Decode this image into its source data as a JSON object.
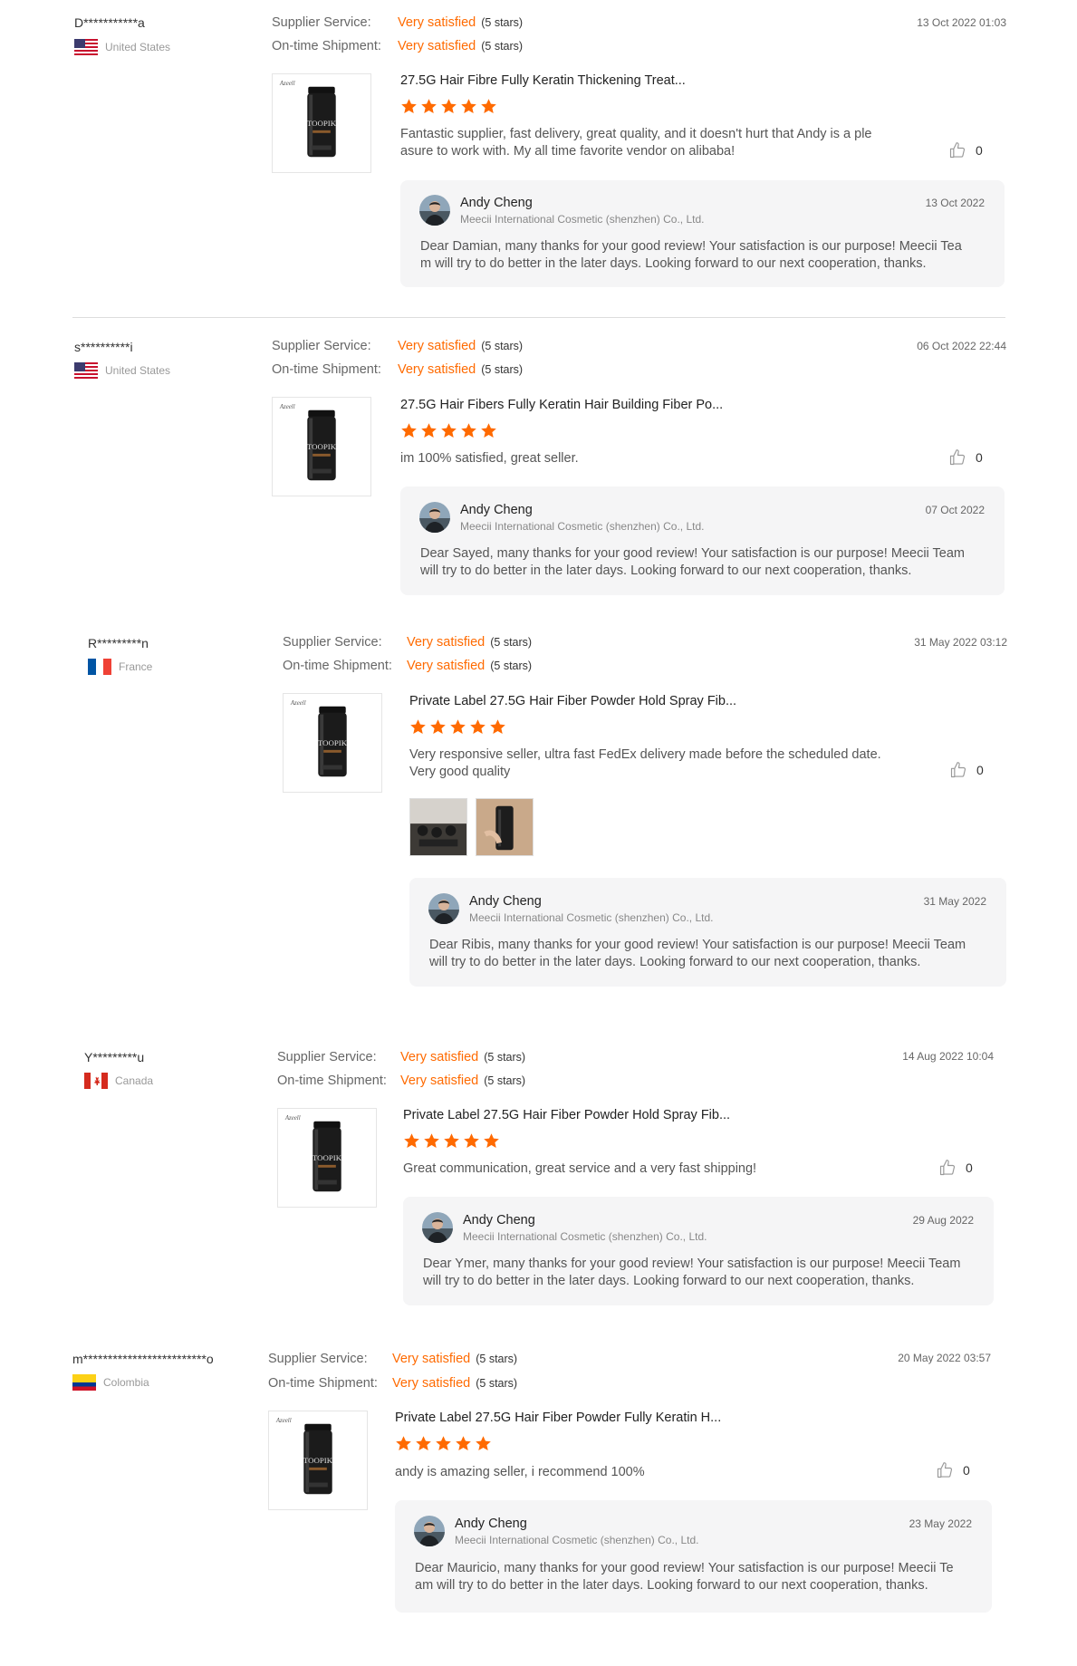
{
  "colors": {
    "accent": "#ff6a00",
    "star": "#ff6a00"
  },
  "labels": {
    "supplier_service": "Supplier Service:",
    "on_time_shipment": "On-time Shipment:"
  },
  "reviews": [
    {
      "buyer": "D***********a",
      "country": "United States",
      "flag": "us-flag-icon",
      "supplier_rating": "Very satisfied",
      "supplier_stars": "(5 stars)",
      "shipment_rating": "Very satisfied",
      "shipment_stars": "(5 stars)",
      "date": "13 Oct 2022 01:03",
      "product_title": "27.5G Hair Fibre Fully Keratin Thickening Treat...",
      "rating": 5,
      "comment_line1": "Fantastic supplier, fast delivery, great quality, and it doesn't hurt that Andy is a ple",
      "comment_line2": "asure to work with. My all time favorite vendor on alibaba!",
      "likes": "0",
      "reply": {
        "name": "Andy Cheng",
        "company": "Meecii International Cosmetic (shenzhen) Co., Ltd.",
        "date": "13 Oct 2022",
        "line1": "Dear Damian, many thanks for your good review! Your satisfaction is our purpose! Meecii Tea",
        "line2": "m will try to do better in the later days. Looking forward to our next cooperation, thanks."
      }
    },
    {
      "buyer": "s**********i",
      "country": "United States",
      "flag": "us-flag-icon",
      "supplier_rating": "Very satisfied",
      "supplier_stars": "(5 stars)",
      "shipment_rating": "Very satisfied",
      "shipment_stars": "(5 stars)",
      "date": "06 Oct 2022 22:44",
      "product_title": "27.5G Hair Fibers Fully Keratin Hair Building Fiber Po...",
      "rating": 5,
      "comment_line1": "im 100% satisfied, great seller.",
      "comment_line2": "",
      "likes": "0",
      "reply": {
        "name": "Andy Cheng",
        "company": "Meecii International Cosmetic (shenzhen) Co., Ltd.",
        "date": "07 Oct 2022",
        "line1": "Dear Sayed, many thanks for your good review! Your satisfaction is our purpose! Meecii Team",
        "line2": "will try to do better in the later days. Looking forward to our next cooperation, thanks."
      }
    },
    {
      "buyer": "R*********n",
      "country": "France",
      "flag": "france-flag-icon",
      "supplier_rating": "Very satisfied",
      "supplier_stars": "(5 stars)",
      "shipment_rating": "Very satisfied",
      "shipment_stars": "(5 stars)",
      "date": "31 May 2022 03:12",
      "product_title": "Private Label 27.5G Hair Fiber Powder Hold Spray Fib...",
      "rating": 5,
      "comment_line1": "Very responsive seller, ultra fast FedEx delivery made before the scheduled date.",
      "comment_line2": "Very good quality",
      "likes": "0",
      "reply": {
        "name": "Andy Cheng",
        "company": "Meecii International Cosmetic (shenzhen) Co., Ltd.",
        "date": "31 May 2022",
        "line1": "Dear Ribis,  many thanks for your good review! Your satisfaction is our purpose! Meecii Team",
        "line2": "will try to do better in the later days. Looking forward to our next cooperation, thanks."
      }
    },
    {
      "buyer": "Y*********u",
      "country": "Canada",
      "flag": "canada-flag-icon",
      "supplier_rating": "Very satisfied",
      "supplier_stars": "(5 stars)",
      "shipment_rating": "Very satisfied",
      "shipment_stars": "(5 stars)",
      "date": "14 Aug 2022 10:04",
      "product_title": "Private Label 27.5G Hair Fiber Powder Hold Spray Fib...",
      "rating": 5,
      "comment_line1": "Great communication, great service and a very fast shipping!",
      "comment_line2": "",
      "likes": "0",
      "reply": {
        "name": "Andy Cheng",
        "company": "Meecii International Cosmetic (shenzhen) Co., Ltd.",
        "date": "29 Aug 2022",
        "line1": "Dear Ymer, many thanks for your good review! Your satisfaction is our purpose! Meecii Team",
        "line2": "will try to do better in the later days. Looking forward to our next cooperation, thanks."
      }
    },
    {
      "buyer": "m*************************o",
      "country": "Colombia",
      "flag": "colombia-flag-icon",
      "supplier_rating": "Very satisfied",
      "supplier_stars": "(5 stars)",
      "shipment_rating": "Very satisfied",
      "shipment_stars": "(5 stars)",
      "date": "20 May 2022 03:57",
      "product_title": "Private Label 27.5G Hair Fiber Powder Fully Keratin H...",
      "rating": 5,
      "comment_line1": "andy is amazing seller, i recommend 100%",
      "comment_line2": "",
      "likes": "0",
      "reply": {
        "name": "Andy Cheng",
        "company": "Meecii International Cosmetic (shenzhen) Co., Ltd.",
        "date": "23 May 2022",
        "line1": "Dear Mauricio,  many thanks for your good review! Your satisfaction is our purpose! Meecii Te",
        "line2": "am will try to do better in the later days. Looking forward to our next cooperation, thanks."
      }
    }
  ]
}
